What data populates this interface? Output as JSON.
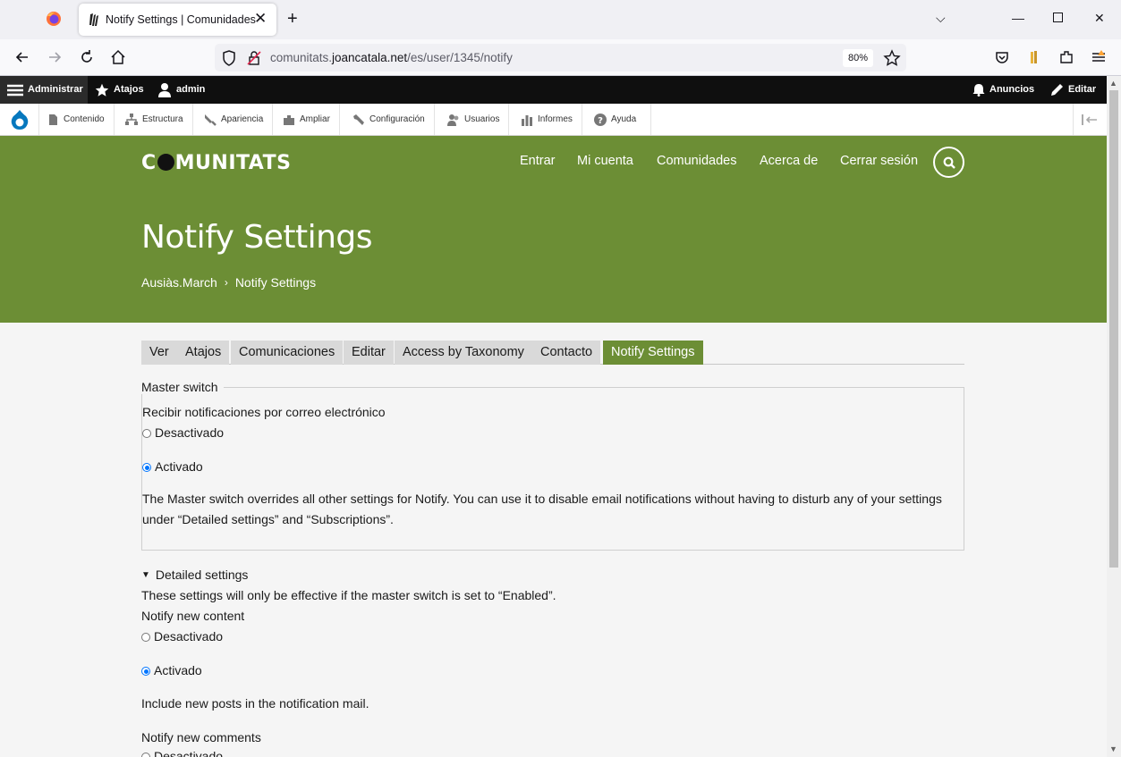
{
  "browser": {
    "tab_title": "Notify Settings | Comunidades",
    "url_prefix": "comunitats.",
    "url_domain": "joancatala.net",
    "url_path": "/es/user/1345/notify",
    "zoom": "80%"
  },
  "admin_toolbar": {
    "administrar": "Administrar",
    "atajos": "Atajos",
    "user": "admin",
    "anuncios": "Anuncios",
    "editar": "Editar"
  },
  "admin_tray": [
    {
      "label": "Contenido",
      "icon": "file-icon"
    },
    {
      "label": "Estructura",
      "icon": "structure-icon"
    },
    {
      "label": "Apariencia",
      "icon": "brush-icon"
    },
    {
      "label": "Ampliar",
      "icon": "puzzle-icon"
    },
    {
      "label": "Configuración",
      "icon": "wrench-icon"
    },
    {
      "label": "Usuarios",
      "icon": "users-icon"
    },
    {
      "label": "Informes",
      "icon": "bar-chart-icon"
    },
    {
      "label": "Ayuda",
      "icon": "help-icon"
    }
  ],
  "site": {
    "logo_pre": "C",
    "logo_post": "MUNITATS",
    "nav": [
      "Entrar",
      "Mi cuenta",
      "Comunidades",
      "Acerca de",
      "Cerrar sesión"
    ],
    "accent": "#6c8e35"
  },
  "page": {
    "title": "Notify Settings",
    "breadcrumb": [
      "Ausiàs.March",
      "Notify Settings"
    ],
    "tabs": [
      "Ver",
      "Atajos",
      "Comunicaciones",
      "Editar",
      "Access by Taxonomy",
      "Contacto",
      "Notify Settings"
    ],
    "active_tab": "Notify Settings"
  },
  "form": {
    "master_legend": "Master switch",
    "master_label": "Recibir notificaciones por correo electrónico",
    "opt_off": "Desactivado",
    "opt_on": "Activado",
    "master_desc": "The Master switch overrides all other settings for Notify. You can use it to disable email notifications without having to disturb any of your settings under “Detailed settings” and “Subscriptions”.",
    "detailed_summary": "Detailed settings",
    "detailed_desc": "These settings will only be effective if the master switch is set to “Enabled”.",
    "content_label": "Notify new content",
    "content_desc": "Include new posts in the notification mail.",
    "comments_label": "Notify new comments"
  }
}
